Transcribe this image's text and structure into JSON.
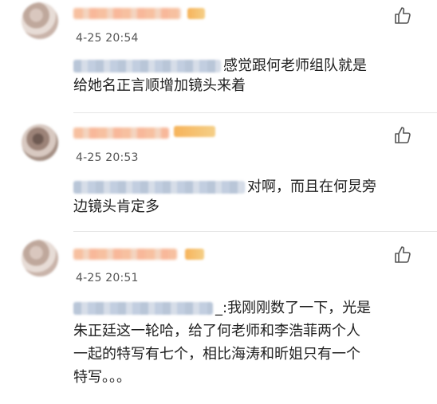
{
  "comments": [
    {
      "time": "4-25 20:54",
      "text_line1": "感觉跟何老师组队就是",
      "text_line2": "给她名正言顺增加镜头来着"
    },
    {
      "time": "4-25 20:53",
      "text_line1": "对啊，而且在何炅旁",
      "text_line2": "边镜头肯定多"
    },
    {
      "time": "4-25 20:51",
      "text_line1": "_:我刚刚数了一下，光是",
      "text_line2": "朱正廷这一轮哈，给了何老师和李浩菲两个人",
      "text_line3": "一起的特写有七个，相比海涛和昕姐只有一个",
      "text_line4": "特写。。。"
    }
  ],
  "icons": {
    "like": "thumbs-up-icon"
  },
  "colors": {
    "time": "#555555",
    "text": "#1f1f1f",
    "divider": "#e6e6e6"
  }
}
